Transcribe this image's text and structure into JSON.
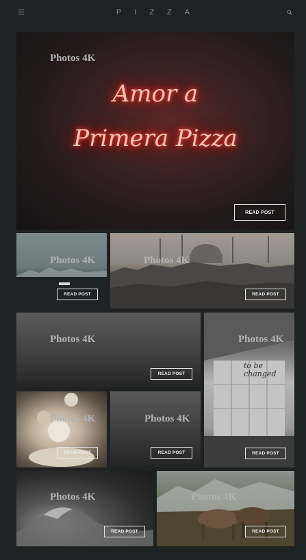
{
  "header": {
    "brand": "PIZZA",
    "menu_icon": "hamburger-menu-icon",
    "search_icon": "search-icon"
  },
  "posts": [
    {
      "title": "Photos 4K",
      "button": "READ POST",
      "neon_line1": "Amor a",
      "neon_line2": "Primera Pizza"
    },
    {
      "title": "Photos 4K",
      "button": "READ POST"
    },
    {
      "title": "Photos 4K",
      "button": "READ POST"
    },
    {
      "title": "Photos 4K",
      "button": "READ POST"
    },
    {
      "title": "Photos 4K",
      "button": "READ POST",
      "sign_text": "to be changed"
    },
    {
      "title": "Photos 4K",
      "button": "READ POST"
    },
    {
      "title": "Photos 4K",
      "button": "READ POST"
    },
    {
      "title": "Photos 4K",
      "button": "READ POST"
    },
    {
      "title": "Photos 4K",
      "button": "READ POST"
    }
  ],
  "colors": {
    "background": "#1f2223",
    "header_text": "#8f9394",
    "tile_title": "#b3b3b3",
    "button_border": "#e8e8e8",
    "neon_red": "#e4201a"
  }
}
